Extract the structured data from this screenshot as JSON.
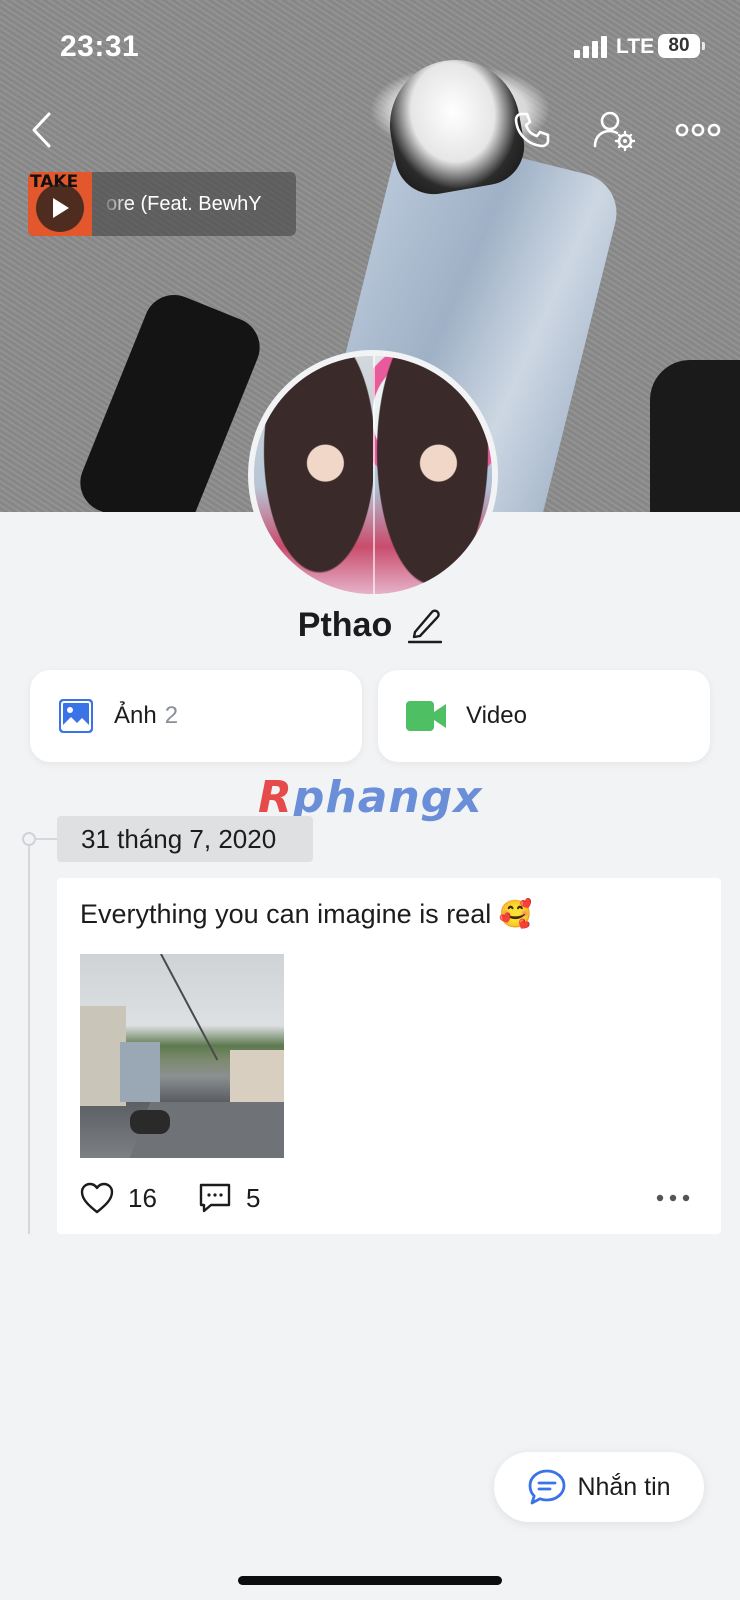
{
  "status_bar": {
    "time": "23:31",
    "network": "LTE",
    "battery": "80"
  },
  "music": {
    "album_text": "TAKE",
    "song_title": "ore (Feat. BewhY"
  },
  "profile": {
    "name": "Pthao"
  },
  "media": {
    "photos": {
      "label": "Ảnh",
      "count": "2"
    },
    "videos": {
      "label": "Video"
    }
  },
  "watermark": {
    "part1": "R",
    "part2": "phangx"
  },
  "timeline": {
    "date": "31 tháng 7, 2020",
    "post": {
      "text": "Everything you can imagine is real 🥰",
      "likes": "16",
      "comments": "5"
    }
  },
  "message_button": {
    "label": "Nhắn tin"
  },
  "colors": {
    "photo_icon": "#3a73e8",
    "video_icon": "#4fbf63",
    "chat_icon": "#3a73e8"
  }
}
